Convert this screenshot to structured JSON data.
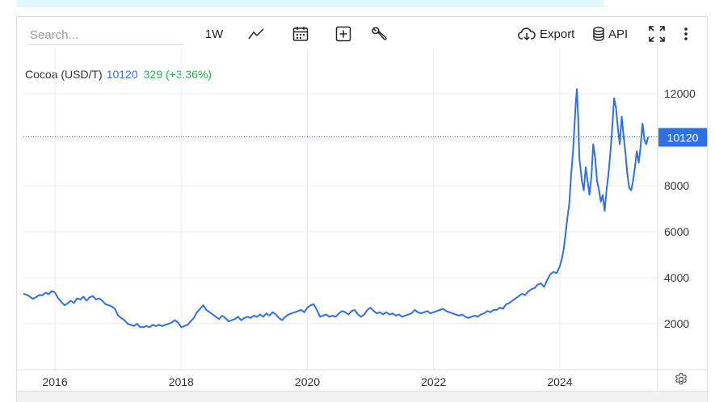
{
  "search": {
    "placeholder": "Search..."
  },
  "toolbar": {
    "period_label": "1W",
    "export_label": "Export",
    "api_label": "API",
    "icons": {
      "chart_type": "line-chart-icon",
      "calendar": "calendar-icon",
      "compare": "plus-square-icon",
      "tools": "wrench-icon",
      "export": "cloud-download-icon",
      "api": "database-icon",
      "fullscreen": "fullscreen-icon",
      "more": "more-vertical-icon",
      "settings": "gear-icon"
    }
  },
  "legend": {
    "name": "Cocoa (USD/T)",
    "price": "10120",
    "change": "329 (+3.36%)"
  },
  "colors": {
    "line": "#2f6fe8",
    "price_tag": "#2f6fe8",
    "change_positive": "#21b34a",
    "grid": "#ececec",
    "axis_text": "#333333"
  },
  "chart_data": {
    "type": "line",
    "title": "",
    "xlabel": "",
    "ylabel": "",
    "x_tick_labels": [
      "2016",
      "2018",
      "2020",
      "2022",
      "2024"
    ],
    "x_ticks": [
      2016,
      2018,
      2020,
      2022,
      2024
    ],
    "y_ticks": [
      2000,
      4000,
      6000,
      8000,
      10000,
      12000
    ],
    "y_tick_labels": [
      "2000",
      "4000",
      "6000",
      "8000",
      "",
      "12000"
    ],
    "xlim": [
      2015.5,
      2025.55
    ],
    "ylim": [
      0,
      14000
    ],
    "last_price_label": "10120",
    "last_price": 10120,
    "grid": true,
    "series": [
      {
        "name": "Cocoa (USD/T)",
        "points": [
          [
            2015.5,
            3300
          ],
          [
            2015.55,
            3260
          ],
          [
            2015.6,
            3180
          ],
          [
            2015.65,
            3080
          ],
          [
            2015.7,
            3150
          ],
          [
            2015.75,
            3250
          ],
          [
            2015.8,
            3230
          ],
          [
            2015.85,
            3350
          ],
          [
            2015.9,
            3280
          ],
          [
            2015.95,
            3420
          ],
          [
            2016.0,
            3350
          ],
          [
            2016.05,
            3100
          ],
          [
            2016.1,
            2950
          ],
          [
            2016.15,
            2800
          ],
          [
            2016.2,
            2880
          ],
          [
            2016.25,
            3000
          ],
          [
            2016.3,
            2900
          ],
          [
            2016.35,
            3100
          ],
          [
            2016.4,
            3050
          ],
          [
            2016.45,
            3180
          ],
          [
            2016.5,
            3000
          ],
          [
            2016.55,
            3150
          ],
          [
            2016.6,
            3200
          ],
          [
            2016.65,
            3050
          ],
          [
            2016.7,
            3100
          ],
          [
            2016.75,
            3000
          ],
          [
            2016.8,
            2850
          ],
          [
            2016.85,
            2800
          ],
          [
            2016.9,
            2750
          ],
          [
            2016.95,
            2650
          ],
          [
            2017.0,
            2350
          ],
          [
            2017.05,
            2250
          ],
          [
            2017.1,
            2150
          ],
          [
            2017.15,
            2000
          ],
          [
            2017.2,
            1950
          ],
          [
            2017.25,
            1900
          ],
          [
            2017.3,
            2000
          ],
          [
            2017.35,
            1850
          ],
          [
            2017.4,
            1850
          ],
          [
            2017.45,
            1900
          ],
          [
            2017.5,
            1850
          ],
          [
            2017.55,
            1950
          ],
          [
            2017.6,
            1900
          ],
          [
            2017.65,
            1950
          ],
          [
            2017.7,
            1900
          ],
          [
            2017.75,
            1950
          ],
          [
            2017.8,
            2000
          ],
          [
            2017.85,
            2050
          ],
          [
            2017.9,
            2150
          ],
          [
            2017.95,
            2050
          ],
          [
            2018.0,
            1850
          ],
          [
            2018.05,
            1900
          ],
          [
            2018.1,
            1950
          ],
          [
            2018.15,
            2100
          ],
          [
            2018.2,
            2250
          ],
          [
            2018.25,
            2500
          ],
          [
            2018.3,
            2650
          ],
          [
            2018.35,
            2800
          ],
          [
            2018.4,
            2600
          ],
          [
            2018.45,
            2500
          ],
          [
            2018.5,
            2400
          ],
          [
            2018.55,
            2300
          ],
          [
            2018.6,
            2200
          ],
          [
            2018.65,
            2350
          ],
          [
            2018.7,
            2250
          ],
          [
            2018.75,
            2100
          ],
          [
            2018.8,
            2150
          ],
          [
            2018.85,
            2200
          ],
          [
            2018.9,
            2300
          ],
          [
            2018.95,
            2150
          ],
          [
            2019.0,
            2250
          ],
          [
            2019.05,
            2300
          ],
          [
            2019.1,
            2250
          ],
          [
            2019.15,
            2350
          ],
          [
            2019.2,
            2300
          ],
          [
            2019.25,
            2400
          ],
          [
            2019.3,
            2300
          ],
          [
            2019.35,
            2450
          ],
          [
            2019.4,
            2350
          ],
          [
            2019.45,
            2500
          ],
          [
            2019.5,
            2400
          ],
          [
            2019.55,
            2250
          ],
          [
            2019.6,
            2150
          ],
          [
            2019.65,
            2300
          ],
          [
            2019.7,
            2400
          ],
          [
            2019.75,
            2450
          ],
          [
            2019.8,
            2500
          ],
          [
            2019.85,
            2550
          ],
          [
            2019.9,
            2600
          ],
          [
            2019.95,
            2500
          ],
          [
            2020.0,
            2700
          ],
          [
            2020.05,
            2800
          ],
          [
            2020.1,
            2850
          ],
          [
            2020.15,
            2600
          ],
          [
            2020.2,
            2300
          ],
          [
            2020.25,
            2350
          ],
          [
            2020.3,
            2400
          ],
          [
            2020.35,
            2300
          ],
          [
            2020.4,
            2350
          ],
          [
            2020.45,
            2300
          ],
          [
            2020.5,
            2450
          ],
          [
            2020.55,
            2550
          ],
          [
            2020.6,
            2500
          ],
          [
            2020.65,
            2400
          ],
          [
            2020.7,
            2550
          ],
          [
            2020.75,
            2600
          ],
          [
            2020.8,
            2400
          ],
          [
            2020.85,
            2300
          ],
          [
            2020.9,
            2400
          ],
          [
            2020.95,
            2600
          ],
          [
            2021.0,
            2700
          ],
          [
            2021.05,
            2550
          ],
          [
            2021.1,
            2450
          ],
          [
            2021.15,
            2500
          ],
          [
            2021.2,
            2400
          ],
          [
            2021.25,
            2500
          ],
          [
            2021.3,
            2400
          ],
          [
            2021.35,
            2450
          ],
          [
            2021.4,
            2350
          ],
          [
            2021.45,
            2400
          ],
          [
            2021.5,
            2300
          ],
          [
            2021.55,
            2350
          ],
          [
            2021.6,
            2400
          ],
          [
            2021.65,
            2450
          ],
          [
            2021.7,
            2600
          ],
          [
            2021.75,
            2500
          ],
          [
            2021.8,
            2450
          ],
          [
            2021.85,
            2500
          ],
          [
            2021.9,
            2550
          ],
          [
            2021.95,
            2450
          ],
          [
            2022.0,
            2500
          ],
          [
            2022.05,
            2550
          ],
          [
            2022.1,
            2600
          ],
          [
            2022.15,
            2650
          ],
          [
            2022.2,
            2550
          ],
          [
            2022.25,
            2500
          ],
          [
            2022.3,
            2450
          ],
          [
            2022.35,
            2400
          ],
          [
            2022.4,
            2350
          ],
          [
            2022.45,
            2400
          ],
          [
            2022.5,
            2300
          ],
          [
            2022.55,
            2250
          ],
          [
            2022.6,
            2300
          ],
          [
            2022.65,
            2350
          ],
          [
            2022.7,
            2300
          ],
          [
            2022.75,
            2400
          ],
          [
            2022.8,
            2450
          ],
          [
            2022.85,
            2550
          ],
          [
            2022.9,
            2500
          ],
          [
            2022.95,
            2600
          ],
          [
            2023.0,
            2600
          ],
          [
            2023.05,
            2700
          ],
          [
            2023.1,
            2650
          ],
          [
            2023.15,
            2850
          ],
          [
            2023.2,
            2900
          ],
          [
            2023.25,
            3000
          ],
          [
            2023.3,
            3100
          ],
          [
            2023.35,
            3200
          ],
          [
            2023.4,
            3300
          ],
          [
            2023.45,
            3250
          ],
          [
            2023.5,
            3400
          ],
          [
            2023.55,
            3500
          ],
          [
            2023.6,
            3550
          ],
          [
            2023.65,
            3700
          ],
          [
            2023.7,
            3750
          ],
          [
            2023.75,
            3600
          ],
          [
            2023.8,
            3900
          ],
          [
            2023.85,
            4150
          ],
          [
            2023.9,
            4250
          ],
          [
            2023.95,
            4200
          ],
          [
            2024.0,
            4500
          ],
          [
            2024.03,
            4800
          ],
          [
            2024.06,
            5200
          ],
          [
            2024.09,
            5900
          ],
          [
            2024.12,
            6600
          ],
          [
            2024.15,
            7200
          ],
          [
            2024.18,
            8500
          ],
          [
            2024.21,
            9500
          ],
          [
            2024.23,
            10500
          ],
          [
            2024.25,
            11500
          ],
          [
            2024.27,
            12200
          ],
          [
            2024.29,
            11000
          ],
          [
            2024.31,
            9200
          ],
          [
            2024.33,
            8700
          ],
          [
            2024.35,
            8200
          ],
          [
            2024.38,
            7800
          ],
          [
            2024.41,
            8800
          ],
          [
            2024.44,
            8200
          ],
          [
            2024.47,
            7600
          ],
          [
            2024.5,
            8400
          ],
          [
            2024.53,
            9800
          ],
          [
            2024.56,
            9200
          ],
          [
            2024.59,
            8200
          ],
          [
            2024.62,
            7800
          ],
          [
            2024.65,
            7300
          ],
          [
            2024.68,
            7600
          ],
          [
            2024.71,
            6900
          ],
          [
            2024.74,
            7800
          ],
          [
            2024.77,
            8500
          ],
          [
            2024.8,
            9400
          ],
          [
            2024.83,
            10500
          ],
          [
            2024.86,
            11800
          ],
          [
            2024.89,
            11400
          ],
          [
            2024.92,
            10500
          ],
          [
            2024.95,
            9800
          ],
          [
            2024.98,
            11000
          ],
          [
            2025.01,
            10200
          ],
          [
            2025.04,
            9400
          ],
          [
            2025.07,
            8500
          ],
          [
            2025.1,
            7900
          ],
          [
            2025.13,
            7800
          ],
          [
            2025.16,
            8200
          ],
          [
            2025.19,
            8800
          ],
          [
            2025.22,
            9500
          ],
          [
            2025.25,
            9000
          ],
          [
            2025.28,
            9700
          ],
          [
            2025.31,
            10700
          ],
          [
            2025.34,
            10000
          ],
          [
            2025.37,
            9800
          ],
          [
            2025.4,
            10120
          ]
        ]
      }
    ]
  }
}
